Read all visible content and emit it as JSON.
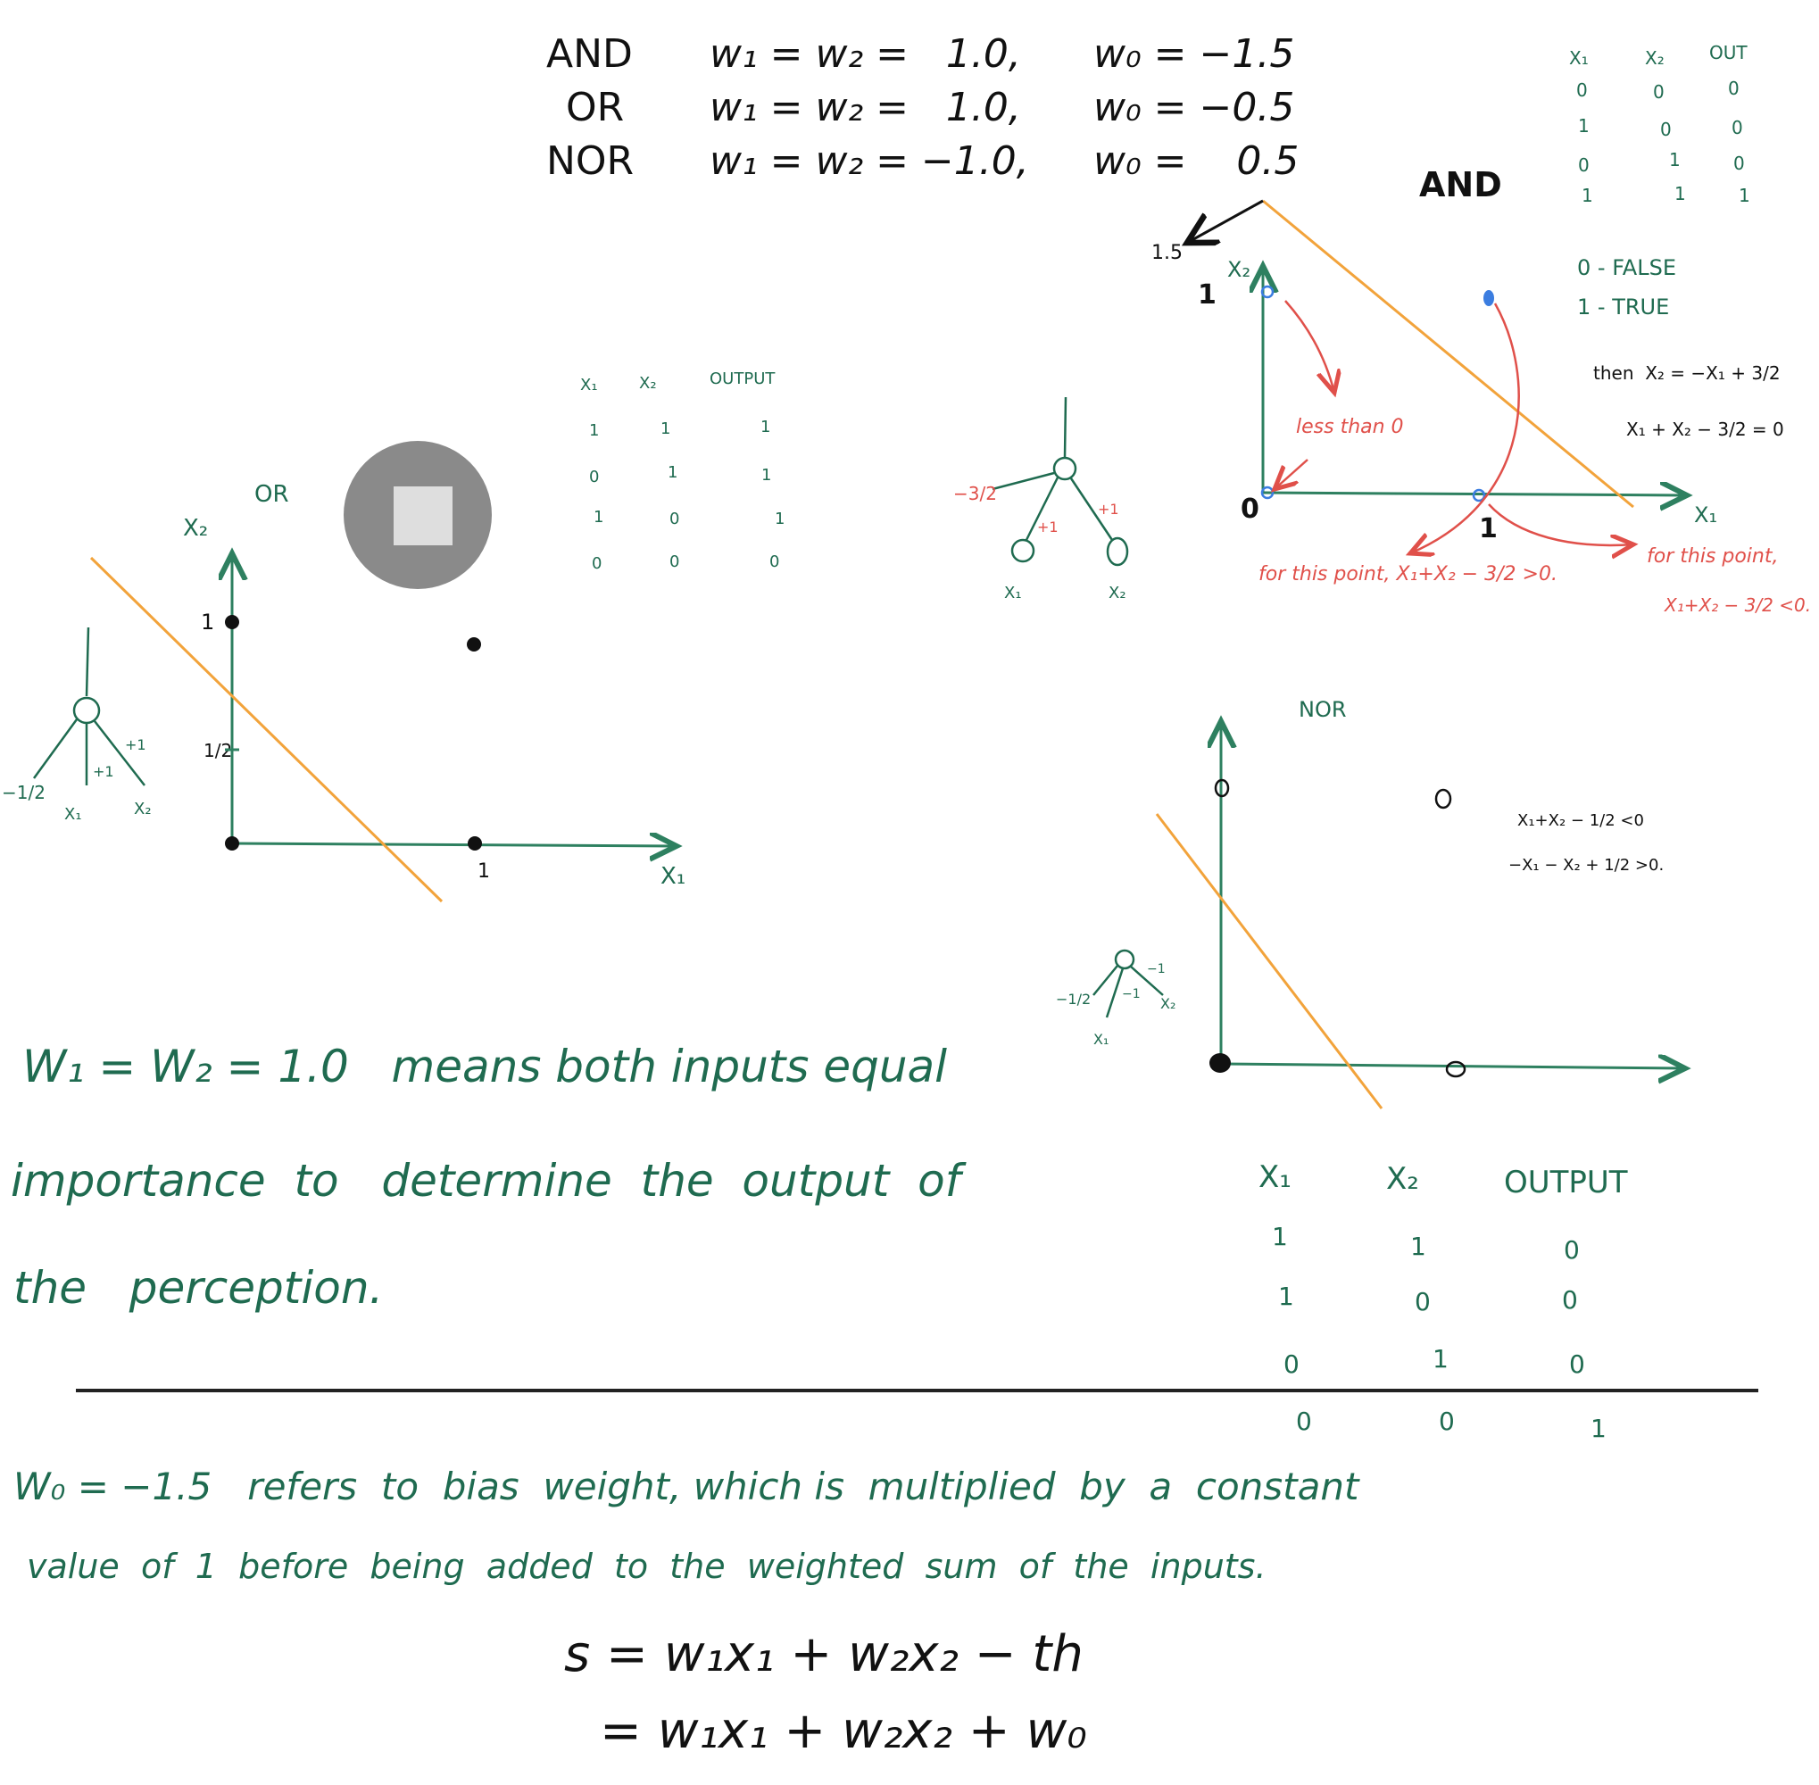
{
  "weights_table": [
    {
      "gate": "AND",
      "w12": "w₁ = w₂ =   1.0,",
      "w0": "w₀ = −1.5"
    },
    {
      "gate": "OR",
      "w12": "w₁ = w₂ =   1.0,",
      "w0": "w₀ = −0.5"
    },
    {
      "gate": "NOR",
      "w12": "w₁ = w₂ = −1.0,",
      "w0": "w₀ =    0.5"
    }
  ],
  "and_truth_table": {
    "headers": [
      "X₁",
      "X₂",
      "OUT"
    ],
    "rows": [
      [
        "0",
        "0",
        "0"
      ],
      [
        "1",
        "0",
        "0"
      ],
      [
        "0",
        "1",
        "0"
      ],
      [
        "1",
        "1",
        "1"
      ]
    ]
  },
  "legend": {
    "zero": "0 - FALSE",
    "one": "1 - TRUE"
  },
  "and_section": {
    "title": "AND",
    "axis_x": "X₁",
    "axis_y": "X₂",
    "tick_y_1": "1",
    "tick_x_1": "1",
    "origin": "0",
    "arrow_label": "1.5",
    "eq1": "then  X₂ = −X₁ + 3/2",
    "eq2": "X₁ + X₂ − 3/2 = 0",
    "less_than": "less than 0",
    "point_left": "for this point, X₁+X₂ − 3/2 >0.",
    "point_right_a": "for this point,",
    "point_right_b": "X₁+X₂ − 3/2 <0."
  },
  "and_perceptron": {
    "bias": "−3/2",
    "w1": "+1",
    "w2": "+1",
    "in1": "X₁",
    "in2": "X₂"
  },
  "or_section": {
    "title": "OR",
    "axis_x": "X₁",
    "axis_y": "X₂",
    "tick_y_1": "1",
    "tick_y_half": "1/2",
    "tick_x_1": "1"
  },
  "or_truth_table": {
    "headers": [
      "X₁",
      "X₂",
      "OUTPUT"
    ],
    "rows": [
      [
        "1",
        "1",
        "1"
      ],
      [
        "0",
        "1",
        "1"
      ],
      [
        "1",
        "0",
        "1"
      ],
      [
        "0",
        "0",
        "0"
      ]
    ]
  },
  "or_perceptron": {
    "bias": "−1/2",
    "w1": "+1",
    "w2": "+1",
    "in1": "X₁",
    "in2": "X₂"
  },
  "nor_section": {
    "title": "NOR",
    "ineq1": "X₁+X₂ − 1/2 <0",
    "ineq2": "−X₁ − X₂ + 1/2 >0."
  },
  "nor_perceptron": {
    "bias": "−1/2",
    "w1": "−1",
    "w2": "−1",
    "in1": "X₁",
    "in2": "X₂"
  },
  "nor_truth_table": {
    "headers": [
      "X₁",
      "X₂",
      "OUTPUT"
    ],
    "rows": [
      [
        "1",
        "1",
        "0"
      ],
      [
        "1",
        "0",
        "0"
      ],
      [
        "0",
        "1",
        "0"
      ],
      [
        "0",
        "0",
        "1"
      ]
    ]
  },
  "notes": {
    "w_line1": "W₁ = W₂ = 1.0   means both inputs equal",
    "w_line2": "importance  to   determine  the  output  of",
    "w_line3": "the   perception.",
    "bias_line1": "W₀ = −1.5   refers  to  bias  weight, which is  multiplied  by  a  constant",
    "bias_line2": "value  of  1  before  being  added  to  the  weighted  sum  of  the  inputs."
  },
  "formula": {
    "line1": "s = w₁x₁ + w₂x₂ − th",
    "line2": "= w₁x₁ + w₂x₂ + w₀"
  }
}
